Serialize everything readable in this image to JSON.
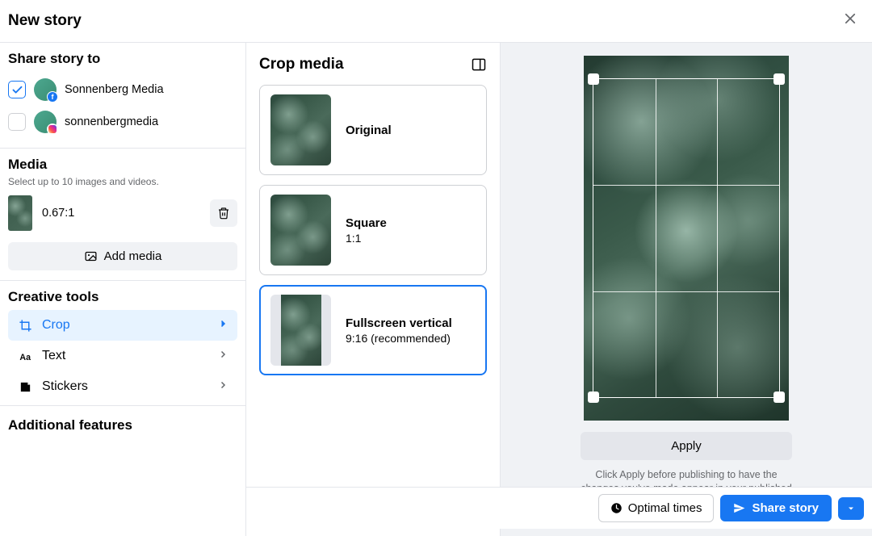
{
  "header": {
    "title": "New story"
  },
  "share": {
    "heading": "Share story to",
    "targets": [
      {
        "label": "Sonnenberg Media",
        "checked": true,
        "platform": "facebook"
      },
      {
        "label": "sonnenbergmedia",
        "checked": false,
        "platform": "instagram"
      }
    ]
  },
  "media": {
    "heading": "Media",
    "hint": "Select up to 10 images and videos.",
    "ratio": "0.67:1",
    "add_label": "Add media"
  },
  "tools": {
    "heading": "Creative tools",
    "items": [
      {
        "label": "Crop",
        "active": true
      },
      {
        "label": "Text",
        "active": false
      },
      {
        "label": "Stickers",
        "active": false
      }
    ]
  },
  "additional": {
    "heading": "Additional features"
  },
  "crop_panel": {
    "heading": "Crop media",
    "options": [
      {
        "title": "Original",
        "sub": "",
        "selected": false
      },
      {
        "title": "Square",
        "sub": "1:1",
        "selected": false
      },
      {
        "title": "Fullscreen vertical",
        "sub": "9:16 (recommended)",
        "selected": true
      }
    ]
  },
  "preview": {
    "apply_label": "Apply",
    "apply_hint": "Click Apply before publishing to have the changes you've made appear in your published story."
  },
  "footer": {
    "optimal_label": "Optimal times",
    "share_label": "Share story"
  }
}
